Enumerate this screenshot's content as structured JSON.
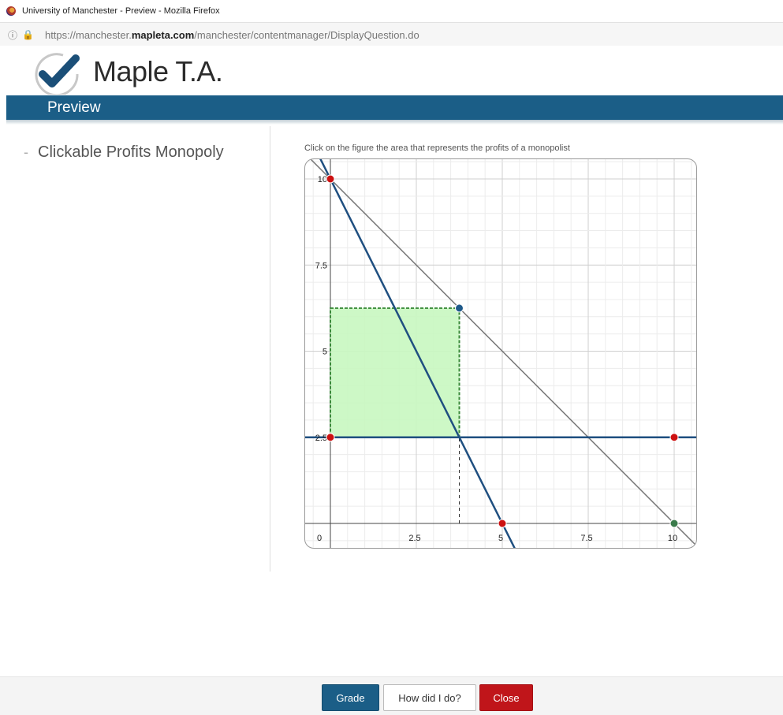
{
  "window": {
    "title": "University of Manchester - Preview - Mozilla Firefox",
    "url_prefix": "https://manchester.",
    "url_domain": "mapleta.com",
    "url_path": "/manchester/contentmanager/DisplayQuestion.do"
  },
  "brand": {
    "logo_text": "Maple T.A.",
    "accent": "#1b5e87"
  },
  "header": {
    "title": "Preview"
  },
  "sidebar": {
    "items": [
      {
        "label": "Clickable Profits Monopoly"
      }
    ]
  },
  "question": {
    "instruction": "Click on the figure the area that represents the profits of a monopolist"
  },
  "chart_data": {
    "type": "line",
    "xlim": [
      0,
      10.5
    ],
    "ylim": [
      0,
      10.6
    ],
    "x_ticks": [
      {
        "value": 0,
        "label": "0"
      },
      {
        "value": 2.5,
        "label": "2.5"
      },
      {
        "value": 5,
        "label": "5"
      },
      {
        "value": 7.5,
        "label": "7.5"
      },
      {
        "value": 10,
        "label": "10"
      }
    ],
    "y_ticks": [
      {
        "value": 2.5,
        "label": "2.5"
      },
      {
        "value": 5,
        "label": "5"
      },
      {
        "value": 7.5,
        "label": "7.5"
      },
      {
        "value": 10,
        "label": "10"
      }
    ],
    "grid": true,
    "series": [
      {
        "points": [
          [
            0,
            10
          ],
          [
            10,
            0
          ]
        ],
        "color": "#777777"
      },
      {
        "points": [
          [
            0,
            10
          ],
          [
            5,
            0
          ]
        ],
        "color": "#1f4f80"
      },
      {
        "points": [
          [
            0,
            2.5
          ],
          [
            10,
            2.5
          ]
        ],
        "color": "#1f4f80"
      }
    ],
    "region": {
      "x0": 0,
      "y0": 2.5,
      "x1": 3.75,
      "y1": 6.25,
      "fill": "#c8f7c0",
      "stroke": "#3a8a3a"
    },
    "dashed_guides": [
      [
        [
          3.75,
          0
        ],
        [
          3.75,
          2.5
        ]
      ]
    ],
    "points": [
      {
        "x": 0,
        "y": 10,
        "color": "#cc1111"
      },
      {
        "x": 0,
        "y": 2.5,
        "color": "#cc1111"
      },
      {
        "x": 5,
        "y": 0,
        "color": "#cc1111"
      },
      {
        "x": 10,
        "y": 2.5,
        "color": "#cc1111"
      },
      {
        "x": 3.75,
        "y": 6.25,
        "color": "#1f5a8a"
      },
      {
        "x": 10,
        "y": 0,
        "color": "#3a7a4a"
      }
    ]
  },
  "buttons": {
    "grade": "Grade",
    "how": "How did I do?",
    "close": "Close"
  }
}
